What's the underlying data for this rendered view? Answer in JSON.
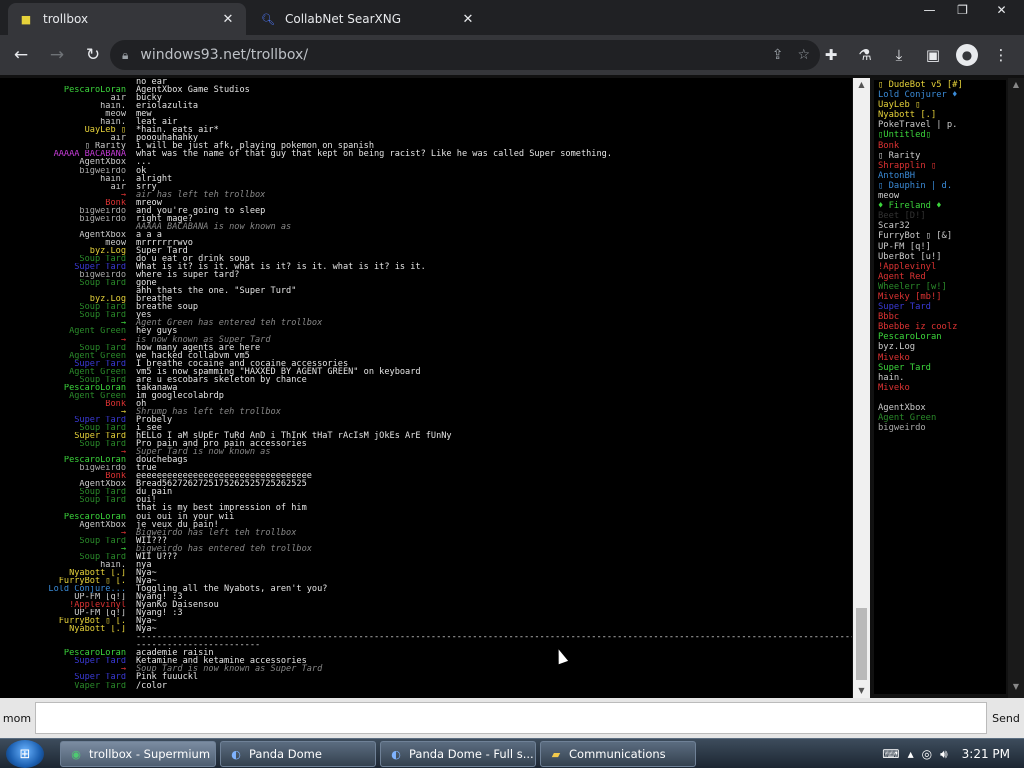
{
  "browser": {
    "tabs": [
      {
        "title": "trollbox",
        "icon": "windows93-icon",
        "active": true
      },
      {
        "title": "CollabNet SearXNG",
        "icon": "search-icon",
        "active": false
      }
    ],
    "url": "windows93.net/trollbox/"
  },
  "messages": [
    {
      "nick": "",
      "color": "#ccc",
      "text": "no ear"
    },
    {
      "nick": "PescaroLoran",
      "color": "#3cd63c",
      "text": "AgentXbox Game Studios"
    },
    {
      "nick": "air",
      "color": "#ccc",
      "text": "bucky"
    },
    {
      "nick": "hain.",
      "color": "#ccc",
      "text": "eriolazulita"
    },
    {
      "nick": "meow",
      "color": "#ccc",
      "text": "mew"
    },
    {
      "nick": "hain.",
      "color": "#ccc",
      "text": "leat air"
    },
    {
      "nick": "UayLeb ▯",
      "color": "#e6d23a",
      "text": "*hain. eats air*"
    },
    {
      "nick": "air",
      "color": "#ccc",
      "text": "pooouhahahky"
    },
    {
      "nick": "▯ Rarity",
      "color": "#ccc",
      "text": "i will be just afk, playing pokemon on spanish"
    },
    {
      "nick": "AAAAA BACABANA",
      "color": "#c43bd6",
      "text": "what was the name of that guy that kept on being racist? Like he was called Super something."
    },
    {
      "nick": "AgentXbox",
      "color": "#ccc",
      "text": "..."
    },
    {
      "nick": "bigweirdo",
      "color": "#aaa",
      "text": "ok"
    },
    {
      "nick": "hain.",
      "color": "#ccc",
      "text": "alright"
    },
    {
      "nick": "air",
      "color": "#ccc",
      "text": "srry"
    },
    {
      "nick": "→",
      "color": "#d33",
      "text": "air has left teh trollbox",
      "system": true
    },
    {
      "nick": "Bonk",
      "color": "#d33",
      "text": "mreow"
    },
    {
      "nick": "bigweirdo",
      "color": "#aaa",
      "text": "and you're going to sleep"
    },
    {
      "nick": "bigweirdo",
      "color": "#aaa",
      "text": "right mage?"
    },
    {
      "nick": "",
      "color": "#ccc",
      "text": "AAAAA BACABANA is now known as",
      "system": true
    },
    {
      "nick": "AgentXbox",
      "color": "#ccc",
      "text": "a a a"
    },
    {
      "nick": "meow",
      "color": "#ccc",
      "text": "mrrrrrrrwvo"
    },
    {
      "nick": "byz.Log",
      "color": "#e6d23a",
      "text": "Super Tard"
    },
    {
      "nick": "Soup Tard",
      "color": "#2a8a2a",
      "text": "do u eat or drink soup"
    },
    {
      "nick": "Super Tard",
      "color": "#3a3ad6",
      "text": "What is it? is it. what is it? is it. what is it? is it."
    },
    {
      "nick": "bigweirdo",
      "color": "#aaa",
      "text": "where is super tard?"
    },
    {
      "nick": "Soup Tard",
      "color": "#2a8a2a",
      "text": "gone"
    },
    {
      "nick": "",
      "color": "#ccc",
      "text": "ahh thats the one. \"Super Turd\""
    },
    {
      "nick": "byz.Log",
      "color": "#e6d23a",
      "text": "breathe"
    },
    {
      "nick": "Soup Tard",
      "color": "#2a8a2a",
      "text": "breathe soup"
    },
    {
      "nick": "Soup Tard",
      "color": "#2a8a2a",
      "text": "yes"
    },
    {
      "nick": "→",
      "color": "#3cd63c",
      "text": "Agent Green has entered teh trollbox",
      "system": true
    },
    {
      "nick": "Agent Green",
      "color": "#2a8a2a",
      "text": "hey guys"
    },
    {
      "nick": "→",
      "color": "#d33",
      "text": "is now known as Super Tard",
      "system": true
    },
    {
      "nick": "Soup Tard",
      "color": "#2a8a2a",
      "text": "how many agents are here"
    },
    {
      "nick": "Agent Green",
      "color": "#2a8a2a",
      "text": "we hacked collabvm vm5"
    },
    {
      "nick": "Super Tard",
      "color": "#3a3ad6",
      "text": "I breathe cocaine and cocaine accessories"
    },
    {
      "nick": "Agent Green",
      "color": "#2a8a2a",
      "text": "vm5 is now spamming \"HAXXED BY AGENT GREEN\" on keyboard"
    },
    {
      "nick": "Soup Tard",
      "color": "#2a8a2a",
      "text": "are u escobars skeleton by chance"
    },
    {
      "nick": "PescaroLoran",
      "color": "#3cd63c",
      "text": "takanawa"
    },
    {
      "nick": "Agent Green",
      "color": "#2a8a2a",
      "text": "im googlecolabrdp"
    },
    {
      "nick": "Bonk",
      "color": "#d33",
      "text": "oh"
    },
    {
      "nick": "→",
      "color": "#e6d23a",
      "text": "Shrump has left teh trollbox",
      "system": true
    },
    {
      "nick": "Super Tard",
      "color": "#3a3ad6",
      "text": "Probely"
    },
    {
      "nick": "Soup Tard",
      "color": "#2a8a2a",
      "text": "i see"
    },
    {
      "nick": "Super Tard",
      "color": "#e6d23a",
      "text": "hELLo I aM sUpEr TuRd AnD i ThInK tHaT rAcIsM jOkEs ArE fUnNy"
    },
    {
      "nick": "Soup Tard",
      "color": "#2a8a2a",
      "text": "Pro pain and pro pain accessories"
    },
    {
      "nick": "→",
      "color": "#d33",
      "text": "Super Tard is now known as",
      "system": true
    },
    {
      "nick": "PescaroLoran",
      "color": "#3cd63c",
      "text": "douchebags"
    },
    {
      "nick": "bigweirdo",
      "color": "#aaa",
      "text": "true"
    },
    {
      "nick": "Bonk",
      "color": "#d33",
      "text": "eeeeeeeeeeeeeeeeeeeeeeeeeeeeeeeeee"
    },
    {
      "nick": "AgentXbox",
      "color": "#ccc",
      "text": "Bread5627262725175262525725262525"
    },
    {
      "nick": "Soup Tard",
      "color": "#2a8a2a",
      "text": "du pain"
    },
    {
      "nick": "Soup Tard",
      "color": "#2a8a2a",
      "text": "oui!"
    },
    {
      "nick": "",
      "color": "#ccc",
      "text": "that is my best impression of him"
    },
    {
      "nick": "PescaroLoran",
      "color": "#3cd63c",
      "text": "oui oui in your wii"
    },
    {
      "nick": "AgentXbox",
      "color": "#ccc",
      "text": "je veux du pain!"
    },
    {
      "nick": "→",
      "color": "#d33",
      "text": "Bigweirdo has left teh trollbox",
      "system": true
    },
    {
      "nick": "Soup Tard",
      "color": "#2a8a2a",
      "text": "WII???"
    },
    {
      "nick": "→",
      "color": "#3cd63c",
      "text": "bigweirdo has entered teh trollbox",
      "system": true
    },
    {
      "nick": "Soup Tard",
      "color": "#2a8a2a",
      "text": "WII U???"
    },
    {
      "nick": "hain.",
      "color": "#ccc",
      "text": "nya"
    },
    {
      "nick": "Nyabott [.]",
      "color": "#e6d23a",
      "text": "Nya~"
    },
    {
      "nick": "FurryBot ▯ [.",
      "color": "#e6d23a",
      "text": "Nya~"
    },
    {
      "nick": "Lold Conjure...",
      "color": "#3a8ad6",
      "text": "Toggling all the Nyabots, aren't you?"
    },
    {
      "nick": "UP-FM [q!]",
      "color": "#ccc",
      "text": "Nyang! :3"
    },
    {
      "nick": "!Applevinyl",
      "color": "#d33",
      "text": "NyanKo Daisensou"
    },
    {
      "nick": "UP-FM [q!]",
      "color": "#ccc",
      "text": "Nyang! :3"
    },
    {
      "nick": "FurryBot ▯ [.",
      "color": "#e6d23a",
      "text": "Nya~"
    },
    {
      "nick": "Nyabott [.]",
      "color": "#e6d23a",
      "text": "Nya~"
    },
    {
      "nick": "",
      "color": "#ccc",
      "text": "------------------------------------------------------------------------------------------------------------------------------------------------",
      "divider": true
    },
    {
      "nick": "",
      "color": "#ccc",
      "text": "------------------------",
      "divider": true
    },
    {
      "nick": "PescaroLoran",
      "color": "#3cd63c",
      "text": "academie raisin"
    },
    {
      "nick": "Super Tard",
      "color": "#3a3ad6",
      "text": "Ketamine and ketamine accessories"
    },
    {
      "nick": "→",
      "color": "#d33",
      "text": "Soup Tard is now known as Super Tard",
      "system": true
    },
    {
      "nick": "Super Tard",
      "color": "#3a3ad6",
      "text": "Pink fuuuckl"
    },
    {
      "nick": "Vaper Tard",
      "color": "#2a8a2a",
      "text": "/color"
    }
  ],
  "users": [
    {
      "name": "▯ DudeBot v5 [#]",
      "color": "#e6d23a"
    },
    {
      "name": "Lold Conjurer ♦",
      "color": "#3a8ad6"
    },
    {
      "name": "UayLeb ▯",
      "color": "#e6d23a"
    },
    {
      "name": "Nyabott [.]",
      "color": "#e6d23a"
    },
    {
      "name": "PokeTravel | p.",
      "color": "#ccc"
    },
    {
      "name": "▯Untitled▯",
      "color": "#3cd63c"
    },
    {
      "name": "Bonk",
      "color": "#d33"
    },
    {
      "name": "▯ Rarity",
      "color": "#ccc"
    },
    {
      "name": "Shrapplin ▯",
      "color": "#d33"
    },
    {
      "name": "AntonBH",
      "color": "#3a8ad6"
    },
    {
      "name": "▯ Dauphin | d.",
      "color": "#3a8ad6"
    },
    {
      "name": "meow",
      "color": "#ccc"
    },
    {
      "name": "♦ Fireland ♦",
      "color": "#3cd63c"
    },
    {
      "name": "Beet [D!]",
      "color": "#333"
    },
    {
      "name": "Scar32",
      "color": "#ccc"
    },
    {
      "name": "FurryBot ▯ [&]",
      "color": "#ccc"
    },
    {
      "name": "UP-FM [q!]",
      "color": "#ccc"
    },
    {
      "name": "UberBot [u!]",
      "color": "#ccc"
    },
    {
      "name": "!Applevinyl",
      "color": "#d33"
    },
    {
      "name": "Agent Red",
      "color": "#d33"
    },
    {
      "name": "Wheelerr [w!]",
      "color": "#2a8a2a"
    },
    {
      "name": "Miveky [mb!]",
      "color": "#d33"
    },
    {
      "name": "Super Tard",
      "color": "#3a3ad6"
    },
    {
      "name": "Bbbc",
      "color": "#d33"
    },
    {
      "name": "Bbebbe iz coolz",
      "color": "#d33"
    },
    {
      "name": "PescaroLoran",
      "color": "#3cd63c"
    },
    {
      "name": "byz.Log",
      "color": "#ccc"
    },
    {
      "name": "Miveko",
      "color": "#d33"
    },
    {
      "name": "Super Tard",
      "color": "#3cd63c"
    },
    {
      "name": "hain.",
      "color": "#ccc"
    },
    {
      "name": "Miveko",
      "color": "#d33"
    },
    {
      "name": "AgentXbox",
      "color": "#ccc",
      "gap": true
    },
    {
      "name": "Agent Green",
      "color": "#2a8a2a"
    },
    {
      "name": "bigweirdo",
      "color": "#aaa"
    }
  ],
  "input": {
    "nick_label": "mom",
    "value": "",
    "send_label": "Send"
  },
  "taskbar": {
    "tasks": [
      {
        "label": "trollbox - Supermium",
        "icon": "supermium-icon",
        "active": true
      },
      {
        "label": "Panda Dome",
        "icon": "panda-icon",
        "active": false
      },
      {
        "label": "Panda Dome - Full s...",
        "icon": "panda-icon",
        "active": false
      },
      {
        "label": "Communications",
        "icon": "folder-icon",
        "active": false
      }
    ],
    "clock": "3:21 PM"
  }
}
